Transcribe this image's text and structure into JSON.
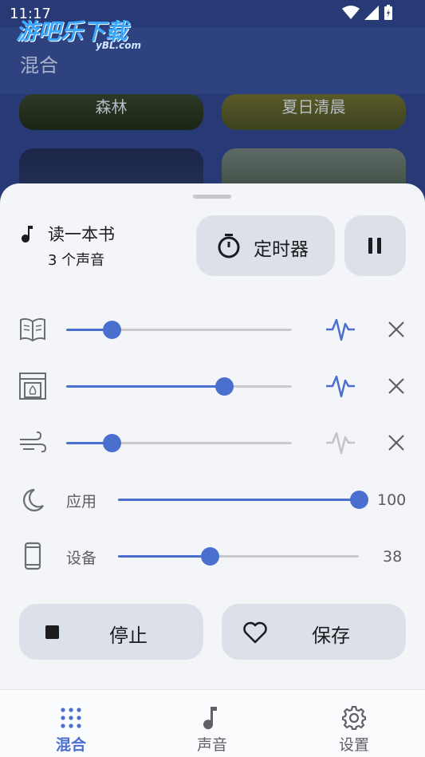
{
  "status_bar": {
    "time": "11:17"
  },
  "watermark": {
    "text": "游吧乐下载",
    "sub": "yBL.com"
  },
  "header": {
    "title": "混合"
  },
  "sound_cards": [
    {
      "label": "森林"
    },
    {
      "label": "夏日清晨"
    },
    {
      "label": ""
    },
    {
      "label": ""
    }
  ],
  "mix": {
    "name": "读一本书",
    "count": "3 个声音"
  },
  "buttons": {
    "timer": "定时器",
    "stop": "停止",
    "save": "保存"
  },
  "sounds": [
    {
      "icon": "book-icon",
      "volume": 0.2,
      "wave_active": true
    },
    {
      "icon": "fireplace-icon",
      "volume": 0.7,
      "wave_active": true
    },
    {
      "icon": "wind-icon",
      "volume": 0.2,
      "wave_active": false
    }
  ],
  "volumes": {
    "app": {
      "label": "应用",
      "value": "100",
      "level": 1.0
    },
    "device": {
      "label": "设备",
      "value": "38",
      "level": 0.38
    }
  },
  "nav": [
    {
      "label": "混合",
      "icon": "grid-dots-icon",
      "active": true
    },
    {
      "label": "声音",
      "icon": "music-note-icon",
      "active": false
    },
    {
      "label": "设置",
      "icon": "gear-icon",
      "active": false
    }
  ],
  "colors": {
    "accent": "#4a6fcf",
    "header_bg": "#2e4280",
    "sheet_bg": "#f4f5f8",
    "button_bg": "#dce0e8"
  }
}
